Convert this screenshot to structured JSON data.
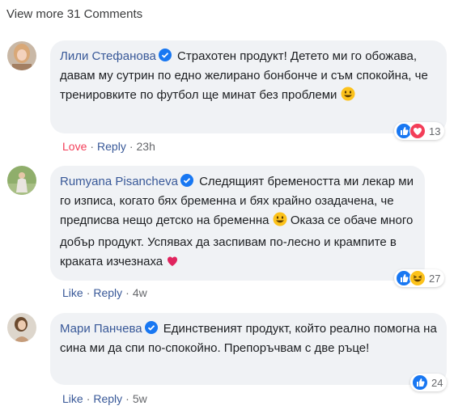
{
  "view_more": "View more 31 Comments",
  "comments": [
    {
      "author": "Лили Стефанова",
      "text": "Страхотен продукт! Детето ми го обожава, давам му сутрин по едно желирано бонбонче и съм спокойна, че тренировките по футбол ще минат без проблеми",
      "react_count": "13",
      "action_react": "Love",
      "action_reply": "Reply",
      "time": "23h"
    },
    {
      "author": "Rumyana Pisancheva",
      "text": "Следящият бремеността ми лекар ми го изписа, когато бях бременна и бях крайно озадачена, че предписва нещо детско на бременна",
      "text_2": "Оказа се обаче много добър продукт. Успявах да заспивам по-лесно и крампите в краката изчезнаха",
      "react_count": "27",
      "action_react": "Like",
      "action_reply": "Reply",
      "time": "4w"
    },
    {
      "author": "Мари Панчева",
      "text": "Единственият продукт, който реално помогна на сина ми да спи по-спокойно. Препоръчвам с две ръце!",
      "react_count": "24",
      "action_react": "Like",
      "action_reply": "Reply",
      "time": "5w"
    }
  ],
  "colors": {
    "link": "#385898",
    "bubble": "#f0f2f5",
    "love": "#f33e58",
    "like": "#1877f2",
    "verified": "#1877f2"
  }
}
